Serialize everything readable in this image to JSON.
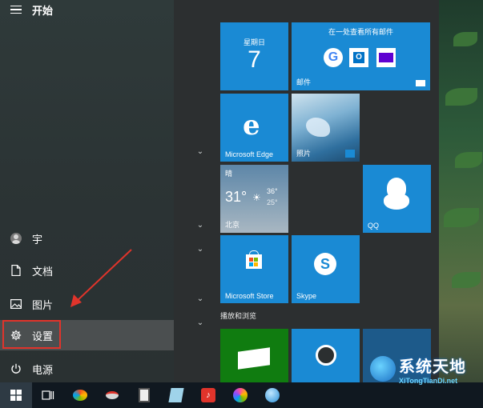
{
  "start_menu": {
    "title": "开始",
    "user": "宇",
    "nav": [
      {
        "label": "文档",
        "icon": "document-icon"
      },
      {
        "label": "图片",
        "icon": "picture-icon"
      },
      {
        "label": "设置",
        "icon": "gear-icon"
      },
      {
        "label": "电源",
        "icon": "power-icon"
      }
    ]
  },
  "tiles": {
    "calendar": {
      "weekday": "星期日",
      "day": "7"
    },
    "mail": {
      "header": "在一处查看所有邮件",
      "label": "邮件"
    },
    "edge": {
      "label": "Microsoft Edge"
    },
    "photos": {
      "label": "照片"
    },
    "weather": {
      "condition": "晴",
      "temp": "31°",
      "high": "36°",
      "low": "25°",
      "city": "北京"
    },
    "qq": {
      "label": "QQ"
    },
    "store": {
      "label": "Microsoft Store"
    },
    "skype": {
      "label": "Skype"
    }
  },
  "group_title": "播放和浏览",
  "watermark": {
    "title": "系统天地",
    "url": "XiTongTianDi.net"
  },
  "colors": {
    "tile_blue": "#1a8ad4",
    "accent_red": "#e0342b",
    "xbox_green": "#107c10"
  }
}
